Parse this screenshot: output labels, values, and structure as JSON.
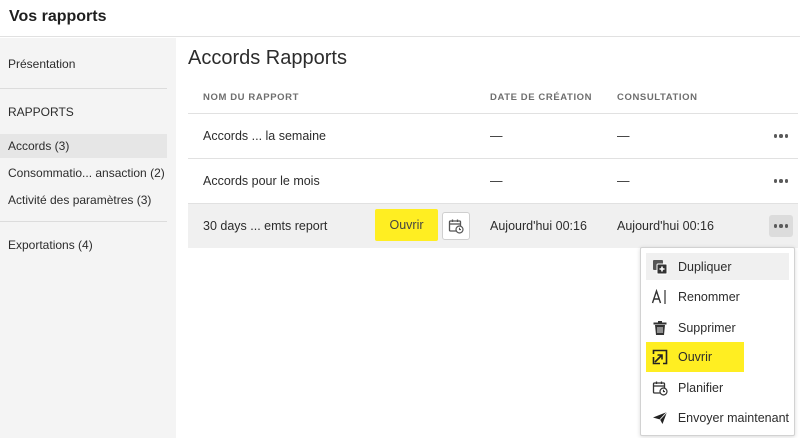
{
  "header": {
    "title": "Vos rapports"
  },
  "sidebar": {
    "items": [
      {
        "label": "Présentation"
      },
      {
        "label": "RAPPORTS"
      },
      {
        "label": "Accords (3)"
      },
      {
        "label": "Consommatio... ansaction (2)"
      },
      {
        "label": "Activité des paramètres (3)"
      },
      {
        "label": "Exportations (4)"
      }
    ]
  },
  "main": {
    "title": "Accords Rapports",
    "columns": [
      "NOM DU RAPPORT",
      "DATE DE CRÉATION",
      "CONSULTATION"
    ],
    "rows": [
      {
        "name": "Accords ... la semaine",
        "created": "—",
        "viewed": "—"
      },
      {
        "name": "Accords pour le mois",
        "created": "—",
        "viewed": "—"
      },
      {
        "name": "30 days ... emts report",
        "created": "Aujourd'hui 00:16",
        "viewed": "Aujourd'hui 00:16",
        "open_label": "Ouvrir"
      }
    ]
  },
  "menu": {
    "items": [
      {
        "label": "Dupliquer",
        "icon": "duplicate-icon"
      },
      {
        "label": "Renommer",
        "icon": "rename-icon"
      },
      {
        "label": "Supprimer",
        "icon": "trash-icon"
      },
      {
        "label": "Ouvrir",
        "icon": "open-icon"
      },
      {
        "label": "Planifier",
        "icon": "calendar-icon"
      },
      {
        "label": "Envoyer maintenant",
        "icon": "send-icon"
      }
    ]
  },
  "colors": {
    "highlight": "#ffee22",
    "sidebar_bg": "#f4f4f4",
    "selected_row": "#f0f0f0"
  }
}
